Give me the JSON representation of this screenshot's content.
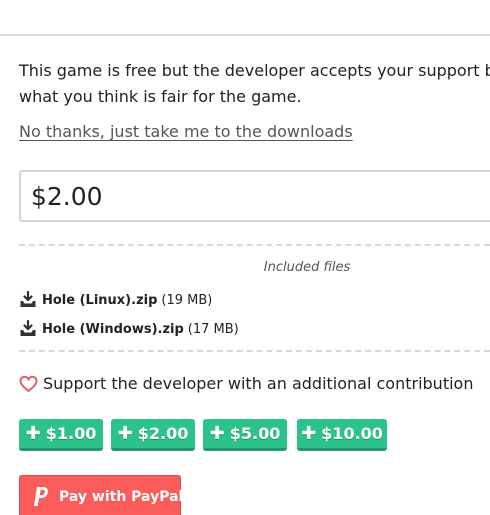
{
  "intro": {
    "line1": "This game is free but the developer accepts your support by letting you pay",
    "line2": "what you think is fair for the game."
  },
  "no_thanks_link": "No thanks, just take me to the downloads",
  "price_input": {
    "value": "$2.00"
  },
  "files": {
    "heading": "Included files",
    "items": [
      {
        "name": "Hole (Linux).zip",
        "size": "(19 MB)"
      },
      {
        "name": "Hole (Windows).zip",
        "size": "(17 MB)"
      }
    ]
  },
  "support": {
    "label": "Support the developer with an additional contribution"
  },
  "amount_buttons": [
    {
      "label": "$1.00"
    },
    {
      "label": "$2.00"
    },
    {
      "label": "$5.00"
    },
    {
      "label": "$10.00"
    }
  ],
  "paypal_button": {
    "label": "Pay with PayPal"
  },
  "icons": {
    "download": "download-icon",
    "heart": "heart-outline-icon",
    "plus": "plus-icon",
    "paypal": "paypal-icon"
  },
  "colors": {
    "accent_green": "#2bc38a",
    "paypal_red": "#fa5c5c",
    "heart_red": "#e35d6a"
  }
}
